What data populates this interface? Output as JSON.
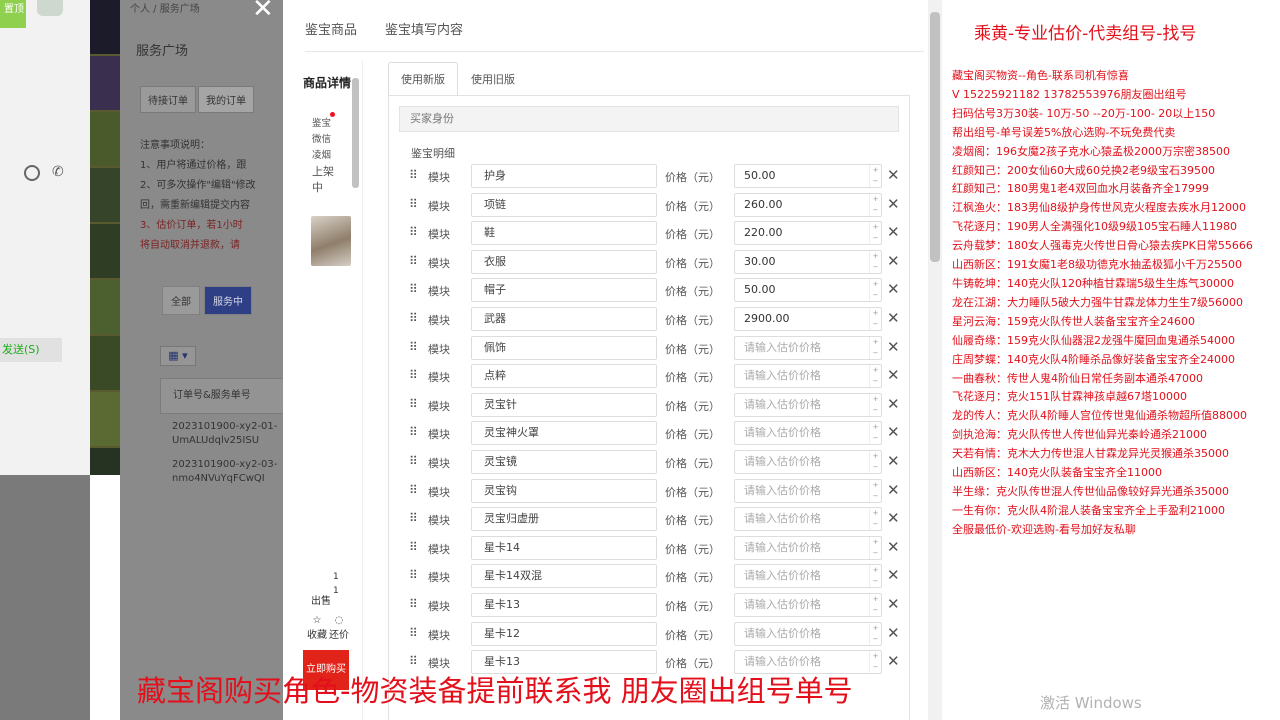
{
  "chat": {
    "top_label": "置顶",
    "send_label": "发送(S)"
  },
  "admin": {
    "breadcrumb": "个人 / 服务广场",
    "title": "服务广场",
    "tabs": [
      "待接订单",
      "我的订单"
    ],
    "notes": [
      "注意事项说明：",
      "1、用户将通过价格，跟",
      "2、可多次操作\"编辑\"修改",
      "回，需重新编辑提交内容",
      "3、估价订单，若1小时",
      "将自动取消并退款，请"
    ],
    "filters": [
      "全部",
      "服务中"
    ],
    "order_header": "订单号&服务单号",
    "orders": [
      [
        "2023101900-xy2-01-",
        "UmALUdqlv25ISU"
      ],
      [
        "2023101900-xy2-03-",
        "nmo4NVuYqFCwQI"
      ]
    ]
  },
  "modal": {
    "tabs": [
      "鉴宝商品",
      "鉴宝填写内容"
    ],
    "goods_title": "商品详情",
    "goods_info": [
      "鉴宝",
      "微信",
      "凌烟",
      "上架",
      "中"
    ],
    "goods_nums": [
      "1",
      "1"
    ],
    "sell_label": "出售",
    "fav_label": "收藏",
    "bargain_label": "还价",
    "buy_label": "立即购买",
    "sub_tabs": [
      "使用新版",
      "使用旧版"
    ],
    "buyer_label": "买家身份",
    "detail_label": "鉴宝明细",
    "module_label": "模块",
    "price_label": "价格（元）",
    "price_placeholder": "请输入估价价格",
    "rows": [
      {
        "name": "护身",
        "price": "50.00"
      },
      {
        "name": "项链",
        "price": "260.00"
      },
      {
        "name": "鞋",
        "price": "220.00"
      },
      {
        "name": "衣服",
        "price": "30.00"
      },
      {
        "name": "帽子",
        "price": "50.00"
      },
      {
        "name": "武器",
        "price": "2900.00"
      },
      {
        "name": "佩饰",
        "price": ""
      },
      {
        "name": "点粹",
        "price": ""
      },
      {
        "name": "灵宝针",
        "price": ""
      },
      {
        "name": "灵宝神火罩",
        "price": ""
      },
      {
        "name": "灵宝镜",
        "price": ""
      },
      {
        "name": "灵宝钩",
        "price": ""
      },
      {
        "name": "灵宝归虚册",
        "price": ""
      },
      {
        "name": "星卡14",
        "price": ""
      },
      {
        "name": "星卡14双混",
        "price": ""
      },
      {
        "name": "星卡13",
        "price": ""
      },
      {
        "name": "星卡12",
        "price": ""
      },
      {
        "name": "星卡13",
        "price": ""
      }
    ]
  },
  "panel": {
    "heading": "乘黄-专业估价-代卖组号-找号",
    "lines": [
      "藏宝阁买物资--角色-联系司机有惊喜",
      "V  15225921182  13782553976朋友圈出组号",
      "扫码估号3万30装- 10万-50 --20万-100- 20以上150",
      "帮出组号-单号误差5%放心选购-不玩免费代卖",
      "凌烟阁：196女魔2孩子克水心猿孟极2000万宗密38500",
      "红颜知己：200女仙60大成60兑换2老9级宝石39500",
      "红颜知己：180男鬼1老4双回血水月装备齐全17999",
      "江枫渔火：183男仙8级护身传世风克火程度去疾水月12000",
      "飞花逐月：190男人全满强化10级9级105宝石睡人11980",
      "云舟载梦：180女人强毒克火传世日骨心猿去疾PK日常55666",
      "山西新区：191女魔1老8级功德克水抽孟极狐小千万25500",
      "牛铸乾坤：140克火队120种植甘霖瑞5级生生炼气30000",
      "龙在江湖：大力睡队5破大力强牛甘霖龙体力生生7级56000",
      "星河云海：159克火队传世人装备宝宝齐全24600",
      "仙履奇缘：159克火队仙器混2龙强牛魔回血鬼通杀54000",
      "庄周梦蝶：140克火队4阶睡杀品像好装备宝宝齐全24000",
      "一曲春秋：传世人鬼4阶仙日常任务副本通杀47000",
      "飞花逐月：克火151队甘霖神孩卓越67塔10000",
      "龙的传人：克火队4阶睡人宫位传世鬼仙通杀物超所值88000",
      "剑执沧海：克火队传世人传世仙异光秦岭通杀21000",
      "天若有情：克木大力传世混人甘霖龙异光灵猴通杀35000",
      "山西新区：140克火队装备宝宝齐全11000",
      "半生缘：克火队传世混人传世仙品像较好异光通杀35000",
      "一生有你：克火队4阶混人装备宝宝齐全上手盈利21000",
      "全服最低价-欢迎选购-看号加好友私聊"
    ]
  },
  "overlay": {
    "caption": "藏宝阁购买角色-物资装备提前联系我     朋友圈出组号单号",
    "watermark": "激活 Windows"
  }
}
